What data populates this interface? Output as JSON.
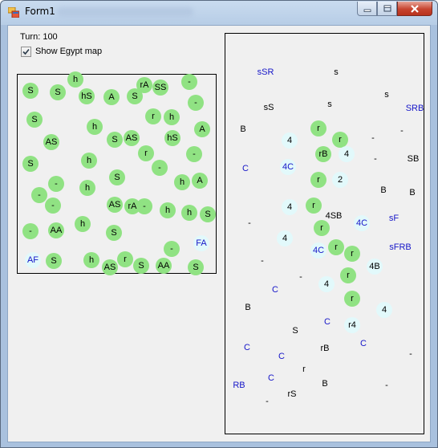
{
  "window": {
    "title": "Form1"
  },
  "controls": {
    "turn_text": "Turn: 100",
    "show_map_label": "Show Egypt map",
    "show_map_checked": true
  },
  "colors": {
    "dot": "#90e283",
    "dot_alt": "#e2f9fb",
    "text": "#000000",
    "text_alt": "#1616c8"
  },
  "left_map": {
    "cells": [
      [
        "h",
        "",
        ""
      ],
      [
        "S",
        "",
        ""
      ],
      [
        "S",
        "",
        ""
      ],
      [
        "rA",
        "",
        ""
      ],
      [
        "SS",
        "",
        ""
      ],
      [
        "-",
        "",
        ""
      ],
      [
        "hS",
        "",
        ""
      ],
      [
        "A",
        "",
        ""
      ],
      [
        "S",
        "",
        ""
      ],
      [
        "-",
        "",
        ""
      ],
      [
        "S",
        "",
        ""
      ],
      [
        "r",
        "",
        ""
      ],
      [
        "h",
        "",
        ""
      ],
      [
        "h",
        "",
        ""
      ],
      [
        "A",
        "",
        ""
      ],
      [
        "AS",
        "",
        ""
      ],
      [
        "S",
        "",
        ""
      ],
      [
        "AS",
        "",
        ""
      ],
      [
        "hS",
        "",
        ""
      ],
      [
        "r",
        "",
        ""
      ],
      [
        "-",
        "",
        ""
      ],
      [
        "S",
        "",
        ""
      ],
      [
        "h",
        "",
        ""
      ],
      [
        "-",
        "",
        ""
      ],
      [
        "S",
        "",
        ""
      ],
      [
        "h",
        "",
        ""
      ],
      [
        "A",
        "",
        ""
      ],
      [
        "-",
        "",
        ""
      ],
      [
        "-",
        "",
        ""
      ],
      [
        "h",
        "",
        ""
      ],
      [
        "-",
        "",
        ""
      ],
      [
        "AS",
        "",
        ""
      ],
      [
        "rA",
        "",
        ""
      ],
      [
        "-",
        "",
        ""
      ],
      [
        "h",
        "",
        ""
      ],
      [
        "h",
        "",
        ""
      ],
      [
        "S",
        "",
        ""
      ],
      [
        "-",
        "",
        ""
      ],
      [
        "AA",
        "",
        ""
      ],
      [
        "h",
        "",
        ""
      ],
      [
        "S",
        "",
        ""
      ],
      [
        "FA",
        "",
        ""
      ],
      [
        "-",
        "",
        ""
      ],
      [
        "AF",
        "",
        ""
      ],
      [
        "S",
        "",
        ""
      ],
      [
        "h",
        "",
        ""
      ],
      [
        "r",
        "",
        ""
      ],
      [
        "AS",
        "",
        ""
      ],
      [
        "S",
        "",
        ""
      ],
      [
        "AA",
        "",
        ""
      ],
      [
        "S",
        "",
        ""
      ]
    ]
  },
  "right_map": {
    "cells": [
      [
        "sSR",
        "",
        ""
      ],
      [
        "s",
        "",
        ""
      ],
      [
        "s",
        "",
        ""
      ],
      [
        "SRB",
        "",
        ""
      ],
      [
        "sS",
        "",
        ""
      ],
      [
        "s",
        "",
        ""
      ],
      [
        "B",
        "",
        ""
      ],
      [
        "r",
        "",
        ""
      ],
      [
        "-",
        "",
        ""
      ],
      [
        "4",
        "",
        ""
      ],
      [
        "r",
        "",
        ""
      ],
      [
        "-",
        "",
        ""
      ],
      [
        "rB",
        "",
        ""
      ],
      [
        "4",
        "",
        ""
      ],
      [
        "C",
        "",
        ""
      ],
      [
        "4C",
        "",
        ""
      ],
      [
        "SB",
        "",
        ""
      ],
      [
        "-",
        "",
        ""
      ],
      [
        "r",
        "",
        ""
      ],
      [
        "2",
        "",
        ""
      ],
      [
        "B",
        "",
        ""
      ],
      [
        "B",
        "",
        ""
      ],
      [
        "4",
        "",
        ""
      ],
      [
        "r",
        "",
        ""
      ],
      [
        "4SB",
        "",
        ""
      ],
      [
        "4C",
        "",
        ""
      ],
      [
        "sF",
        "",
        ""
      ],
      [
        "-",
        "",
        ""
      ],
      [
        "r",
        "",
        ""
      ],
      [
        "4",
        "",
        ""
      ],
      [
        "4C",
        "",
        ""
      ],
      [
        "r",
        "",
        ""
      ],
      [
        "r",
        "",
        ""
      ],
      [
        "sFRB",
        "",
        ""
      ],
      [
        "-",
        "",
        ""
      ],
      [
        "4B",
        "",
        ""
      ],
      [
        "r",
        "",
        ""
      ],
      [
        "-",
        "",
        ""
      ],
      [
        "4",
        "",
        ""
      ],
      [
        "C",
        "",
        ""
      ],
      [
        "r",
        "",
        ""
      ],
      [
        "4",
        "",
        ""
      ],
      [
        "B",
        "",
        ""
      ],
      [
        "C",
        "",
        ""
      ],
      [
        "r4",
        "",
        ""
      ],
      [
        "S",
        "",
        ""
      ],
      [
        "C",
        "",
        ""
      ],
      [
        "C",
        "",
        ""
      ],
      [
        "rB",
        "",
        ""
      ],
      [
        "C",
        "",
        ""
      ],
      [
        "-",
        "",
        ""
      ],
      [
        "r",
        "",
        ""
      ],
      [
        "C",
        "",
        ""
      ],
      [
        "RB",
        "",
        ""
      ],
      [
        "B",
        "",
        ""
      ],
      [
        "-",
        "",
        ""
      ],
      [
        "rS",
        "",
        ""
      ],
      [
        "-",
        "",
        ""
      ]
    ]
  }
}
